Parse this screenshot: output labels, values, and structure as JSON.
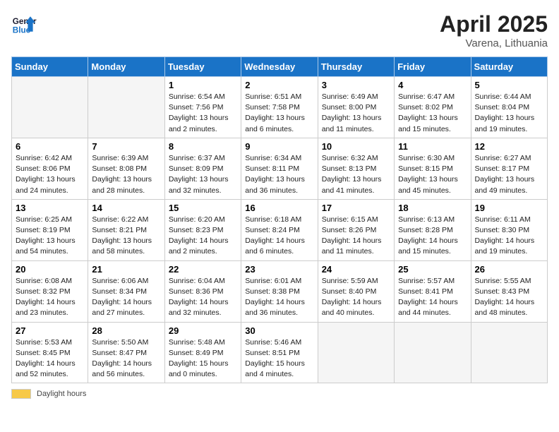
{
  "header": {
    "logo_line1": "General",
    "logo_line2": "Blue",
    "month": "April 2025",
    "location": "Varena, Lithuania"
  },
  "footer": {
    "daylight_label": "Daylight hours"
  },
  "weekdays": [
    "Sunday",
    "Monday",
    "Tuesday",
    "Wednesday",
    "Thursday",
    "Friday",
    "Saturday"
  ],
  "weeks": [
    [
      {
        "day": "",
        "sunrise": "",
        "sunset": "",
        "daylight": ""
      },
      {
        "day": "",
        "sunrise": "",
        "sunset": "",
        "daylight": ""
      },
      {
        "day": "1",
        "sunrise": "Sunrise: 6:54 AM",
        "sunset": "Sunset: 7:56 PM",
        "daylight": "Daylight: 13 hours and 2 minutes."
      },
      {
        "day": "2",
        "sunrise": "Sunrise: 6:51 AM",
        "sunset": "Sunset: 7:58 PM",
        "daylight": "Daylight: 13 hours and 6 minutes."
      },
      {
        "day": "3",
        "sunrise": "Sunrise: 6:49 AM",
        "sunset": "Sunset: 8:00 PM",
        "daylight": "Daylight: 13 hours and 11 minutes."
      },
      {
        "day": "4",
        "sunrise": "Sunrise: 6:47 AM",
        "sunset": "Sunset: 8:02 PM",
        "daylight": "Daylight: 13 hours and 15 minutes."
      },
      {
        "day": "5",
        "sunrise": "Sunrise: 6:44 AM",
        "sunset": "Sunset: 8:04 PM",
        "daylight": "Daylight: 13 hours and 19 minutes."
      }
    ],
    [
      {
        "day": "6",
        "sunrise": "Sunrise: 6:42 AM",
        "sunset": "Sunset: 8:06 PM",
        "daylight": "Daylight: 13 hours and 24 minutes."
      },
      {
        "day": "7",
        "sunrise": "Sunrise: 6:39 AM",
        "sunset": "Sunset: 8:08 PM",
        "daylight": "Daylight: 13 hours and 28 minutes."
      },
      {
        "day": "8",
        "sunrise": "Sunrise: 6:37 AM",
        "sunset": "Sunset: 8:09 PM",
        "daylight": "Daylight: 13 hours and 32 minutes."
      },
      {
        "day": "9",
        "sunrise": "Sunrise: 6:34 AM",
        "sunset": "Sunset: 8:11 PM",
        "daylight": "Daylight: 13 hours and 36 minutes."
      },
      {
        "day": "10",
        "sunrise": "Sunrise: 6:32 AM",
        "sunset": "Sunset: 8:13 PM",
        "daylight": "Daylight: 13 hours and 41 minutes."
      },
      {
        "day": "11",
        "sunrise": "Sunrise: 6:30 AM",
        "sunset": "Sunset: 8:15 PM",
        "daylight": "Daylight: 13 hours and 45 minutes."
      },
      {
        "day": "12",
        "sunrise": "Sunrise: 6:27 AM",
        "sunset": "Sunset: 8:17 PM",
        "daylight": "Daylight: 13 hours and 49 minutes."
      }
    ],
    [
      {
        "day": "13",
        "sunrise": "Sunrise: 6:25 AM",
        "sunset": "Sunset: 8:19 PM",
        "daylight": "Daylight: 13 hours and 54 minutes."
      },
      {
        "day": "14",
        "sunrise": "Sunrise: 6:22 AM",
        "sunset": "Sunset: 8:21 PM",
        "daylight": "Daylight: 13 hours and 58 minutes."
      },
      {
        "day": "15",
        "sunrise": "Sunrise: 6:20 AM",
        "sunset": "Sunset: 8:23 PM",
        "daylight": "Daylight: 14 hours and 2 minutes."
      },
      {
        "day": "16",
        "sunrise": "Sunrise: 6:18 AM",
        "sunset": "Sunset: 8:24 PM",
        "daylight": "Daylight: 14 hours and 6 minutes."
      },
      {
        "day": "17",
        "sunrise": "Sunrise: 6:15 AM",
        "sunset": "Sunset: 8:26 PM",
        "daylight": "Daylight: 14 hours and 11 minutes."
      },
      {
        "day": "18",
        "sunrise": "Sunrise: 6:13 AM",
        "sunset": "Sunset: 8:28 PM",
        "daylight": "Daylight: 14 hours and 15 minutes."
      },
      {
        "day": "19",
        "sunrise": "Sunrise: 6:11 AM",
        "sunset": "Sunset: 8:30 PM",
        "daylight": "Daylight: 14 hours and 19 minutes."
      }
    ],
    [
      {
        "day": "20",
        "sunrise": "Sunrise: 6:08 AM",
        "sunset": "Sunset: 8:32 PM",
        "daylight": "Daylight: 14 hours and 23 minutes."
      },
      {
        "day": "21",
        "sunrise": "Sunrise: 6:06 AM",
        "sunset": "Sunset: 8:34 PM",
        "daylight": "Daylight: 14 hours and 27 minutes."
      },
      {
        "day": "22",
        "sunrise": "Sunrise: 6:04 AM",
        "sunset": "Sunset: 8:36 PM",
        "daylight": "Daylight: 14 hours and 32 minutes."
      },
      {
        "day": "23",
        "sunrise": "Sunrise: 6:01 AM",
        "sunset": "Sunset: 8:38 PM",
        "daylight": "Daylight: 14 hours and 36 minutes."
      },
      {
        "day": "24",
        "sunrise": "Sunrise: 5:59 AM",
        "sunset": "Sunset: 8:40 PM",
        "daylight": "Daylight: 14 hours and 40 minutes."
      },
      {
        "day": "25",
        "sunrise": "Sunrise: 5:57 AM",
        "sunset": "Sunset: 8:41 PM",
        "daylight": "Daylight: 14 hours and 44 minutes."
      },
      {
        "day": "26",
        "sunrise": "Sunrise: 5:55 AM",
        "sunset": "Sunset: 8:43 PM",
        "daylight": "Daylight: 14 hours and 48 minutes."
      }
    ],
    [
      {
        "day": "27",
        "sunrise": "Sunrise: 5:53 AM",
        "sunset": "Sunset: 8:45 PM",
        "daylight": "Daylight: 14 hours and 52 minutes."
      },
      {
        "day": "28",
        "sunrise": "Sunrise: 5:50 AM",
        "sunset": "Sunset: 8:47 PM",
        "daylight": "Daylight: 14 hours and 56 minutes."
      },
      {
        "day": "29",
        "sunrise": "Sunrise: 5:48 AM",
        "sunset": "Sunset: 8:49 PM",
        "daylight": "Daylight: 15 hours and 0 minutes."
      },
      {
        "day": "30",
        "sunrise": "Sunrise: 5:46 AM",
        "sunset": "Sunset: 8:51 PM",
        "daylight": "Daylight: 15 hours and 4 minutes."
      },
      {
        "day": "",
        "sunrise": "",
        "sunset": "",
        "daylight": ""
      },
      {
        "day": "",
        "sunrise": "",
        "sunset": "",
        "daylight": ""
      },
      {
        "day": "",
        "sunrise": "",
        "sunset": "",
        "daylight": ""
      }
    ]
  ]
}
